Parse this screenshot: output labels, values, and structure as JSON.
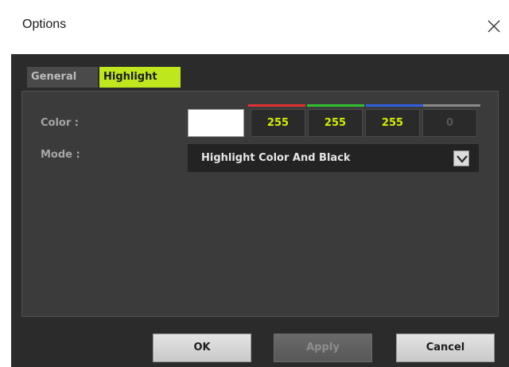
{
  "window": {
    "title": "Options"
  },
  "tabs": [
    {
      "label": "General",
      "active": false
    },
    {
      "label": "Highlight",
      "active": true
    }
  ],
  "highlight": {
    "color_label": "Color :",
    "mode_label": "Mode :",
    "swatch_color": "#ffffff",
    "channels": [
      {
        "value": "255",
        "bar_color": "#e03030"
      },
      {
        "value": "255",
        "bar_color": "#30c030"
      },
      {
        "value": "255",
        "bar_color": "#3060e0"
      },
      {
        "value": "0",
        "bar_color": "#8a8a8a"
      }
    ],
    "mode_value": "Highlight Color And Black"
  },
  "buttons": {
    "ok": "OK",
    "apply": "Apply",
    "cancel": "Cancel"
  },
  "colors": {
    "accent": "#bfe71e",
    "panel": "#3b3b3b",
    "background": "#2b2b2b"
  }
}
